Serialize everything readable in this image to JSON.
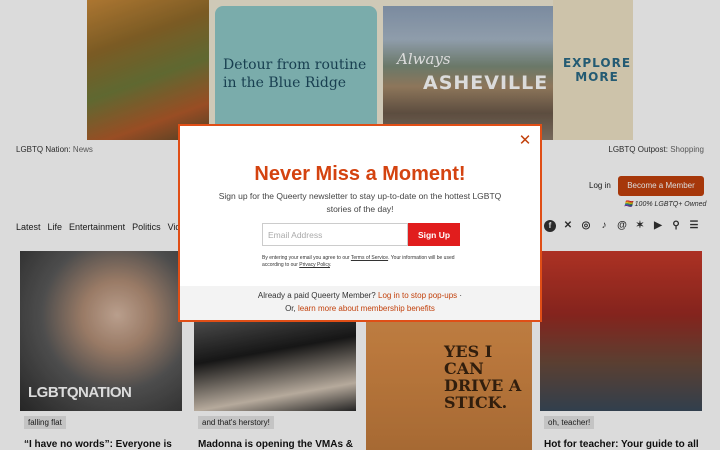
{
  "ad": {
    "detour_text": "Detour from routine in the Blue Ridge",
    "script_text": "Always",
    "city_text": "ASHEVILLE",
    "cta_text": "EXPLORE MORE"
  },
  "header": {
    "left_brand": "LGBTQ Nation",
    "left_section": "News",
    "right_brand": "LGBTQ Outpost",
    "right_section": "Shopping",
    "login": "Log in",
    "member_button": "Become a Member",
    "owned_tag": "🏳️‍🌈 100% LGBTQ+ Owned"
  },
  "nav": {
    "items": [
      "Latest",
      "Life",
      "Entertainment",
      "Politics",
      "Vid"
    ]
  },
  "socials": [
    "facebook-icon",
    "x-icon",
    "instagram-icon",
    "tiktok-icon",
    "threads-icon",
    "bluesky-icon",
    "youtube-icon",
    "search-icon",
    "menu-icon"
  ],
  "cards": [
    {
      "tag": "falling flat",
      "title": "“I have no words”: Everyone is",
      "logo": "LGBTQNATION"
    },
    {
      "tag": "and that's herstory!",
      "title": "Madonna is opening the VMAs &"
    },
    {
      "image_text": "YES I CAN DRIVE A STICK."
    },
    {
      "tag": "oh, teacher!",
      "title": "Hot for teacher: Your guide to all"
    }
  ],
  "modal": {
    "title": "Never Miss a Moment!",
    "subtitle": "Sign up for the Queerty newsletter to stay up-to-date on the hottest LGBTQ stories of the day!",
    "email_placeholder": "Email Address",
    "signup_button": "Sign Up",
    "legal_prefix": "By entering your email you agree to our ",
    "terms_link": "Terms of Service",
    "legal_middle": ". Your information will be used according to our ",
    "privacy_link": "Privacy Policy",
    "legal_suffix": ".",
    "member_text": "Already a paid Queerty Member?",
    "member_link": "Log in to stop pop-ups",
    "member_dot": "·",
    "or_text": "Or,",
    "learn_link": "learn more about membership benefits"
  }
}
